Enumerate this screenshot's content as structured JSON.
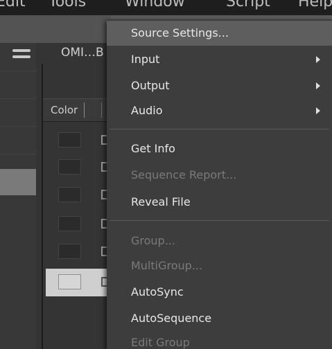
{
  "menubar": {
    "items": [
      "Edit",
      "Tools",
      "Window",
      "Script",
      "Help"
    ]
  },
  "browser": {
    "tab_label": "OMI…B",
    "column_color": "Color"
  },
  "context_menu": {
    "items": [
      {
        "label": "Source Settings...",
        "enabled": true,
        "submenu": false
      },
      {
        "label": "Input",
        "enabled": true,
        "submenu": true
      },
      {
        "label": "Output",
        "enabled": true,
        "submenu": true
      },
      {
        "label": "Audio",
        "enabled": true,
        "submenu": true
      },
      {
        "label": "Get Info",
        "enabled": true,
        "submenu": false
      },
      {
        "label": "Sequence Report...",
        "enabled": false,
        "submenu": false
      },
      {
        "label": "Reveal File",
        "enabled": true,
        "submenu": false
      },
      {
        "label": "Group...",
        "enabled": false,
        "submenu": false
      },
      {
        "label": "MultiGroup...",
        "enabled": false,
        "submenu": false
      },
      {
        "label": "AutoSync",
        "enabled": true,
        "submenu": false
      },
      {
        "label": "AutoSequence",
        "enabled": true,
        "submenu": false
      },
      {
        "label": "Edit Group",
        "enabled": false,
        "submenu": false
      }
    ]
  },
  "colors": {
    "menu_bg": "#3d3d3d",
    "menu_highlight": "#5e5e5e",
    "text": "#e8e8e8",
    "disabled_text": "#7a7a7a"
  }
}
